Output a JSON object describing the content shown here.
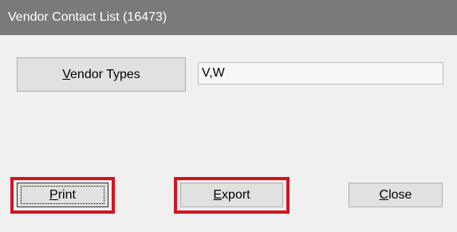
{
  "window": {
    "title": "Vendor Contact List (16473)"
  },
  "vendor_types": {
    "button_label_mnemonic": "V",
    "button_label_rest": "endor Types",
    "value": "V,W"
  },
  "actions": {
    "print_mnemonic": "P",
    "print_rest": "rint",
    "export_mnemonic": "E",
    "export_rest": "xport",
    "close_mnemonic": "C",
    "close_rest": "lose"
  },
  "colors": {
    "titlebar": "#7a7a7a",
    "highlight": "#d3131f",
    "button_face": "#e1e1e1"
  }
}
